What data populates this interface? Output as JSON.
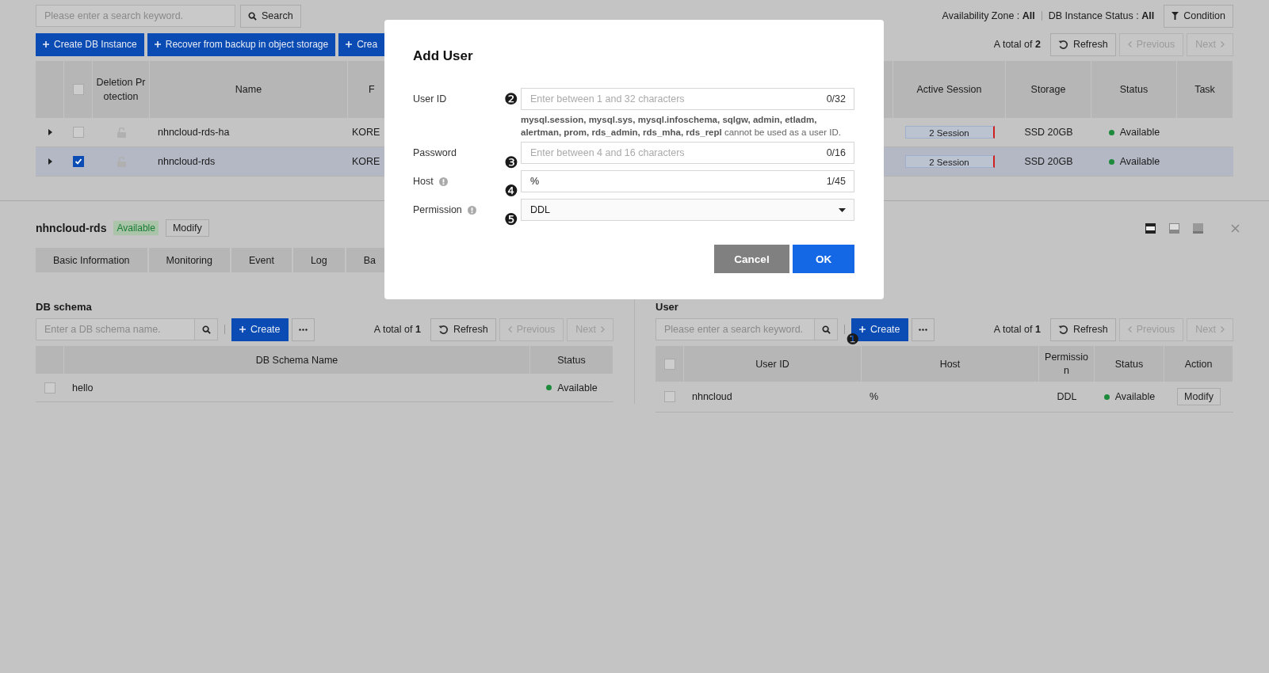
{
  "search": {
    "placeholder": "Please enter a search keyword.",
    "button": "Search"
  },
  "filters": [
    {
      "label": "Availability Zone :",
      "value": "All"
    },
    {
      "label": "DB Instance Status :",
      "value": "All"
    }
  ],
  "condition_button": "Condition",
  "actions": [
    "Create DB Instance",
    "Recover from backup in object storage",
    "Crea"
  ],
  "pager": {
    "total_label": "A total of",
    "total": "2",
    "refresh": "Refresh",
    "previous": {
      "label": "Previous",
      "disabled": true
    },
    "next": {
      "label": "Next",
      "disabled": true
    }
  },
  "instances": {
    "select_all_checked": false,
    "columns_left": [
      "Deletion Protection",
      "Name",
      "F"
    ],
    "columns_right": [
      "Active Session",
      "Storage",
      "Status",
      "Task"
    ],
    "rows": [
      {
        "selected": false,
        "checked": false,
        "name": "nhncloud-rds-ha",
        "column_5": "KORE",
        "session": "2 Session",
        "storage": "SSD 20GB",
        "status": "Available"
      },
      {
        "selected": true,
        "checked": true,
        "name": "nhncloud-rds",
        "column_5": "KORE",
        "session": "2 Session",
        "storage": "SSD 20GB",
        "status": "Available"
      }
    ]
  },
  "detail": {
    "title": "nhncloud-rds",
    "badge": "Available",
    "modify": "Modify",
    "tabs": [
      "Basic Information",
      "Monitoring",
      "Event",
      "Log",
      "Ba"
    ]
  },
  "schema": {
    "title": "DB schema",
    "placeholder": "Enter a DB schema name.",
    "create": "Create",
    "total_label": "A total of",
    "total": "1",
    "refresh": "Refresh",
    "previous": {
      "label": "Previous",
      "disabled": true
    },
    "next": {
      "label": "Next",
      "disabled": true
    },
    "columns": [
      "DB Schema Name",
      "Status"
    ],
    "rows": [
      {
        "checked": false,
        "name": "hello",
        "status": "Available"
      }
    ]
  },
  "user": {
    "title": "User",
    "select_all_checked": false,
    "placeholder": "Please enter a search keyword.",
    "create": "Create",
    "marker": "❶",
    "total_label": "A total of",
    "total": "1",
    "refresh": "Refresh",
    "previous": {
      "label": "Previous",
      "disabled": true
    },
    "next": {
      "label": "Next",
      "disabled": true
    },
    "columns": [
      "User ID",
      "Host",
      "Permission",
      "Status",
      "Action"
    ],
    "rows": [
      {
        "checked": false,
        "user_id": "nhncloud",
        "host": "%",
        "permission": "DDL",
        "status": "Available",
        "action": "Modify"
      }
    ]
  },
  "dialog": {
    "title": "Add User",
    "fields": [
      {
        "kind": "text",
        "label": "User ID",
        "info": false,
        "marker": "❷",
        "placeholder": "Enter between 1 and 32 characters",
        "counter": "0/32",
        "help": "**mysql.session, mysql.sys, mysql.infoschema, sqlgw, admin, etladm, alertman, prom, rds_admin, rds_mha, rds_repl** cannot be used as a user ID."
      },
      {
        "kind": "text",
        "label": "Password",
        "info": false,
        "marker": "❸",
        "placeholder": "Enter between 4 and 16 characters",
        "counter": "0/16"
      },
      {
        "kind": "text",
        "label": "Host",
        "info": true,
        "marker": "❹",
        "value": "%",
        "counter": "1/45"
      },
      {
        "kind": "select",
        "label": "Permission",
        "info": true,
        "marker": "❺",
        "value": "DDL"
      }
    ],
    "cancel": "Cancel",
    "ok": "OK"
  }
}
